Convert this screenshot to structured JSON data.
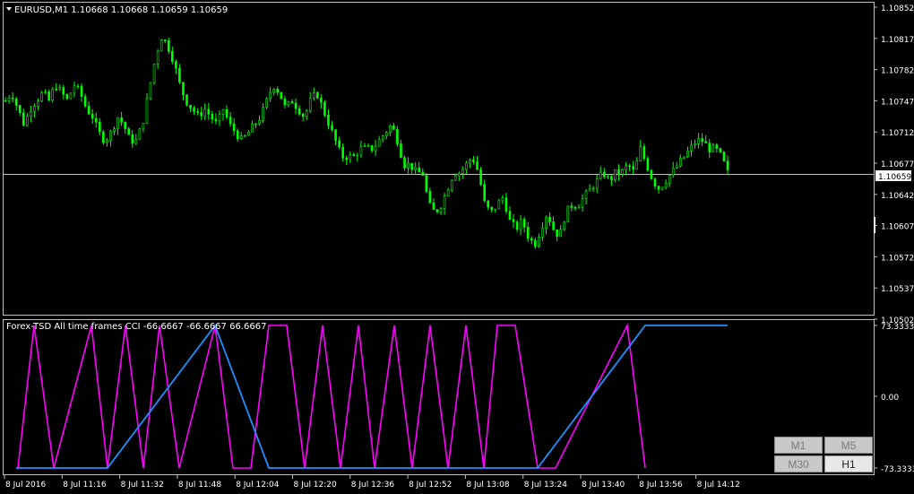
{
  "colors": {
    "background": "#000000",
    "frame": "#c0c0c0",
    "candle": "#00ff00",
    "price_line": "#c0c0c0",
    "cci_current": "#ff00ff",
    "cci_higher": "#1e90ff"
  },
  "main_chart": {
    "title": "EURUSD,M1  1.10668 1.10668 1.10659 1.10659",
    "current_price_label": "1.10659",
    "y_tick_labels": [
      "1.10852",
      "1.10817",
      "1.10782",
      "1.10747",
      "1.10712",
      "1.10677",
      "1.10642",
      "1.10607",
      "1.10572",
      "1.10537",
      "1.10502"
    ]
  },
  "indicator": {
    "title": "Forex-TSD All time frames CCI -66.6667 -66.6667 66.6667",
    "y_tick_labels": [
      "73.3333",
      "0.00",
      "-73.3333"
    ]
  },
  "x_axis": {
    "labels": [
      "8 Jul 2016",
      "8 Jul 11:16",
      "8 Jul 11:32",
      "8 Jul 11:48",
      "8 Jul 12:04",
      "8 Jul 12:20",
      "8 Jul 12:36",
      "8 Jul 12:52",
      "8 Jul 13:08",
      "8 Jul 13:24",
      "8 Jul 13:40",
      "8 Jul 13:56",
      "8 Jul 14:12"
    ]
  },
  "timeframe_buttons": [
    {
      "label": "M1",
      "active": false
    },
    {
      "label": "M5",
      "active": false
    },
    {
      "label": "M30",
      "active": false
    },
    {
      "label": "H1",
      "active": true
    }
  ],
  "chart_data": [
    {
      "type": "candlestick",
      "symbol": "EURUSD",
      "timeframe": "M1",
      "ohlc_last": {
        "open": 1.10668,
        "high": 1.10668,
        "low": 1.10659,
        "close": 1.10659
      },
      "ylim": [
        1.10485,
        1.1087
      ],
      "current_price": 1.10659,
      "close_series": [
        1.1075,
        1.1076,
        1.1074,
        1.1072,
        1.1074,
        1.1075,
        1.1076,
        1.1075,
        1.1077,
        1.1076,
        1.1075,
        1.1077,
        1.1076,
        1.1074,
        1.1073,
        1.1071,
        1.107,
        1.1071,
        1.1073,
        1.1072,
        1.107,
        1.107,
        1.1072,
        1.1076,
        1.108,
        1.1083,
        1.1082,
        1.108,
        1.1077,
        1.1075,
        1.1074,
        1.1073,
        1.1074,
        1.1073,
        1.1072,
        1.1074,
        1.1072,
        1.1071,
        1.107,
        1.1071,
        1.1072,
        1.1073,
        1.1075,
        1.1077,
        1.1076,
        1.1074,
        1.1075,
        1.1074,
        1.1073,
        1.1075,
        1.1076,
        1.1074,
        1.1072,
        1.107,
        1.1068,
        1.1068,
        1.1068,
        1.1069,
        1.1069,
        1.1069,
        1.107,
        1.1071,
        1.1072,
        1.107,
        1.1067,
        1.1067,
        1.1066,
        1.1066,
        1.1062,
        1.1061,
        1.1062,
        1.1064,
        1.1066,
        1.1066,
        1.1067,
        1.1068,
        1.1066,
        1.1062,
        1.1061,
        1.1062,
        1.1063,
        1.106,
        1.1059,
        1.106,
        1.1058,
        1.1057,
        1.1059,
        1.1061,
        1.1059,
        1.1058,
        1.1061,
        1.1062,
        1.1062,
        1.1063,
        1.1064,
        1.1065,
        1.1066,
        1.1065,
        1.1066,
        1.1066,
        1.1067,
        1.1066,
        1.1069,
        1.1067,
        1.1065,
        1.1064,
        1.1065,
        1.1066,
        1.1067,
        1.1068,
        1.1069,
        1.107,
        1.107,
        1.1069,
        1.1069,
        1.1068,
        1.1066
      ]
    },
    {
      "type": "line",
      "title": "Forex-TSD All time frames CCI",
      "ylim": [
        -73.3333,
        73.3333
      ],
      "x": [
        "8 Jul 2016",
        "8 Jul 11:16",
        "8 Jul 11:32",
        "8 Jul 11:48",
        "8 Jul 12:04",
        "8 Jul 12:20",
        "8 Jul 12:36",
        "8 Jul 12:52",
        "8 Jul 13:08",
        "8 Jul 13:24",
        "8 Jul 13:40",
        "8 Jul 13:56",
        "8 Jul 14:12"
      ],
      "series": [
        {
          "color": "#ff00ff",
          "values": [
            -73.3333,
            73.3333,
            -73.3333,
            73.3333,
            -73.3333,
            73.3333,
            -73.3333,
            73.3333,
            -73.3333,
            73.3333,
            -73.3333,
            -73.3333,
            73.3333,
            73.3333,
            -73.3333,
            73.3333,
            -73.3333,
            73.3333,
            -73.3333,
            73.3333,
            -73.3333,
            73.3333,
            -73.3333,
            73.3333,
            -73.3333,
            73.3333,
            73.3333,
            -73.3333,
            -73.3333,
            73.3333,
            -73.3333
          ]
        },
        {
          "color": "#1e90ff",
          "values": [
            -73.3333,
            -73.3333,
            -73.3333,
            73.3333,
            -73.3333,
            -73.3333,
            -73.3333,
            -73.3333,
            73.3333,
            73.3333
          ]
        }
      ]
    }
  ]
}
